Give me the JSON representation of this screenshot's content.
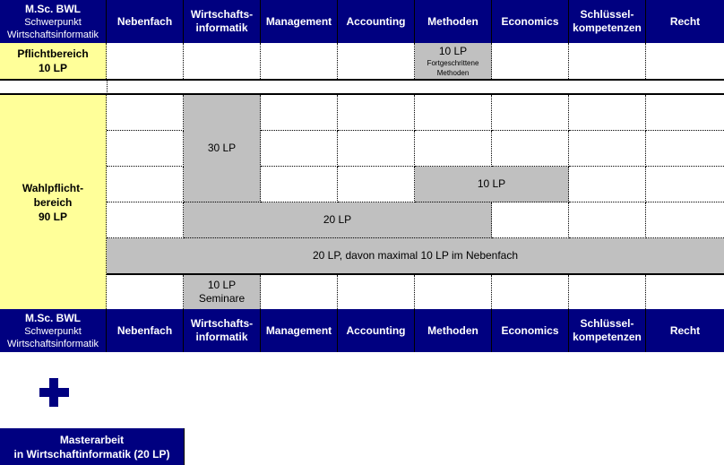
{
  "header": {
    "corner": {
      "line1": "M.Sc. BWL",
      "line2": "Schwerpunkt",
      "line3": "Wirtschaftsinformatik"
    },
    "columns": [
      {
        "line1": "Nebenfach",
        "line2": ""
      },
      {
        "line1": "Wirtschafts-",
        "line2": "informatik"
      },
      {
        "line1": "Management",
        "line2": ""
      },
      {
        "line1": "Accounting",
        "line2": ""
      },
      {
        "line1": "Methoden",
        "line2": ""
      },
      {
        "line1": "Economics",
        "line2": ""
      },
      {
        "line1": "Schlüssel-",
        "line2": "kompetenzen"
      },
      {
        "line1": "Recht",
        "line2": ""
      }
    ]
  },
  "pflicht": {
    "label_line1": "Pflichtbereich",
    "label_line2": "10 LP",
    "methoden_block": {
      "credits": "10 LP",
      "desc_line1": "Fortgeschrittene",
      "desc_line2": "Methoden"
    }
  },
  "wahlpflicht": {
    "label_line1": "Wahlpflicht-",
    "label_line2": "bereich",
    "label_line3": "90 LP",
    "blocks": {
      "wirtschaftsinformatik": "30 LP",
      "methoden_economics": "10 LP",
      "wi_mgmt_acc_methoden": "20 LP",
      "all_columns": "20 LP, davon maximal 10 LP im Nebenfach",
      "seminare_credits": "10 LP",
      "seminare_label": "Seminare"
    }
  },
  "plus_icon": "plus-icon",
  "masterarbeit": {
    "line1": "Masterarbeit",
    "line2": "in Wirtschaftinformatik (20 LP)"
  },
  "colors": {
    "header_bg": "#000080",
    "pflicht_bg": "#ffff99",
    "block_gray": "#c0c0c0"
  }
}
